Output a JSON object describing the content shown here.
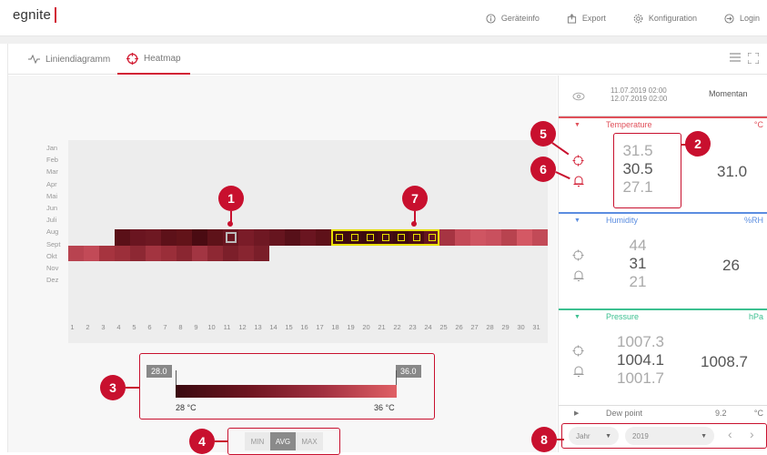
{
  "header": {
    "logo": "egnite",
    "nav": [
      {
        "label": "Geräteinfo",
        "icon": "info-icon"
      },
      {
        "label": "Export",
        "icon": "export-icon"
      },
      {
        "label": "Konfiguration",
        "icon": "gear-icon"
      },
      {
        "label": "Login",
        "icon": "login-icon"
      }
    ]
  },
  "tabs": [
    {
      "label": "Liniendiagramm",
      "icon": "line-chart-icon",
      "active": false
    },
    {
      "label": "Heatmap",
      "icon": "heatmap-icon",
      "active": true
    }
  ],
  "heatmap": {
    "months": [
      "Jan",
      "Feb",
      "Mar",
      "Apr",
      "Mai",
      "Jun",
      "Juli",
      "Aug",
      "Sept",
      "Okt",
      "Nov",
      "Dez"
    ],
    "days": [
      "1",
      "2",
      "3",
      "4",
      "5",
      "6",
      "7",
      "8",
      "9",
      "10",
      "11",
      "12",
      "13",
      "14",
      "15",
      "16",
      "17",
      "18",
      "19",
      "20",
      "21",
      "22",
      "23",
      "24",
      "25",
      "26",
      "27",
      "28",
      "29",
      "30",
      "31"
    ],
    "rows": {
      "Juli": {
        "from_day": 4,
        "to_day": 31,
        "colors": [
          "#5a1018",
          "#6a1520",
          "#6e1822",
          "#5d1119",
          "#621319",
          "#4a0b12",
          "#5e1219",
          "#6a1621",
          "#7a1c28",
          "#6f1823",
          "#66151f",
          "#571019",
          "#6a1520",
          "#5e1119",
          "#3f0a10",
          "#400a10",
          "#3c0a0f",
          "#460b12",
          "#3f0a10",
          "#4c0c13",
          "#641420",
          "#a63442",
          "#c44a58",
          "#cf5562",
          "#c9505e",
          "#b8434f",
          "#d45864",
          "#c24a57"
        ]
      },
      "Aug": {
        "from_day": 1,
        "to_day": 13,
        "colors": [
          "#b84350",
          "#c24a57",
          "#a6343f",
          "#9c2f3a",
          "#8d2833",
          "#a33440",
          "#9a2e39",
          "#8a2631",
          "#a23542",
          "#8e2833",
          "#7c1f2a",
          "#882530",
          "#7a1e29"
        ]
      }
    },
    "selected_cell": {
      "month": "Juli",
      "day": 11
    },
    "highlight_range": {
      "month": "Juli",
      "from_day": 18,
      "to_day": 24
    }
  },
  "legend": {
    "min_box": "28.0",
    "max_box": "36.0",
    "min_label": "28 °C",
    "max_label": "36 °C"
  },
  "aggregation": {
    "options": [
      "MIN",
      "AVG",
      "MAX"
    ],
    "selected": "AVG"
  },
  "annotations": [
    "1",
    "2",
    "3",
    "4",
    "5",
    "6",
    "7",
    "8"
  ],
  "sidebar": {
    "eye_icon": "eye-icon",
    "date_from": "11.07.2019 02:00",
    "date_to": "12.07.2019 02:00",
    "moment_label": "Momentan",
    "sensors": [
      {
        "name": "Temperature",
        "unit": "°C",
        "color": "#e0505a",
        "max": "31.5",
        "avg": "30.5",
        "min": "27.1",
        "current": "31.0"
      },
      {
        "name": "Humidity",
        "unit": "%RH",
        "color": "#5b8de0",
        "max": "44",
        "avg": "31",
        "min": "21",
        "current": "26"
      },
      {
        "name": "Pressure",
        "unit": "hPa",
        "color": "#3cc090",
        "max": "1007.3",
        "avg": "1004.1",
        "min": "1001.7",
        "current": "1008.7"
      }
    ],
    "dewpoint": {
      "name": "Dew point",
      "value": "9.2",
      "unit": "°C"
    },
    "period_select": "Jahr",
    "year_select": "2019"
  }
}
